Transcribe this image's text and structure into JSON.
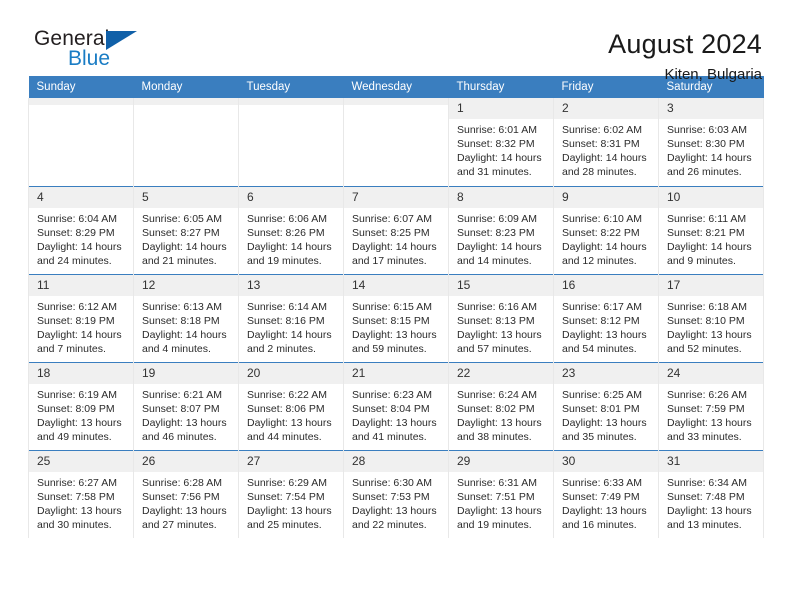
{
  "brand": {
    "name_part1": "General",
    "name_part2": "Blue",
    "triangle_icon": "triangle-icon",
    "accent_color": "#1060a8",
    "link_color": "#1a7cc4"
  },
  "header": {
    "title": "August 2024",
    "subtitle": "Kiten, Bulgaria"
  },
  "calendar": {
    "header_bg": "#3a7ebf",
    "daynum_bg": "#f0f0f0",
    "weekday_headers": [
      "Sunday",
      "Monday",
      "Tuesday",
      "Wednesday",
      "Thursday",
      "Friday",
      "Saturday"
    ],
    "weeks": [
      [
        {
          "day": "",
          "empty": true,
          "sunrise": "",
          "sunset": "",
          "daylight_line1": "",
          "daylight_line2": ""
        },
        {
          "day": "",
          "empty": true,
          "sunrise": "",
          "sunset": "",
          "daylight_line1": "",
          "daylight_line2": ""
        },
        {
          "day": "",
          "empty": true,
          "sunrise": "",
          "sunset": "",
          "daylight_line1": "",
          "daylight_line2": ""
        },
        {
          "day": "",
          "empty": true,
          "sunrise": "",
          "sunset": "",
          "daylight_line1": "",
          "daylight_line2": ""
        },
        {
          "day": "1",
          "empty": false,
          "sunrise": "Sunrise: 6:01 AM",
          "sunset": "Sunset: 8:32 PM",
          "daylight_line1": "Daylight: 14 hours",
          "daylight_line2": "and 31 minutes."
        },
        {
          "day": "2",
          "empty": false,
          "sunrise": "Sunrise: 6:02 AM",
          "sunset": "Sunset: 8:31 PM",
          "daylight_line1": "Daylight: 14 hours",
          "daylight_line2": "and 28 minutes."
        },
        {
          "day": "3",
          "empty": false,
          "sunrise": "Sunrise: 6:03 AM",
          "sunset": "Sunset: 8:30 PM",
          "daylight_line1": "Daylight: 14 hours",
          "daylight_line2": "and 26 minutes."
        }
      ],
      [
        {
          "day": "4",
          "empty": false,
          "sunrise": "Sunrise: 6:04 AM",
          "sunset": "Sunset: 8:29 PM",
          "daylight_line1": "Daylight: 14 hours",
          "daylight_line2": "and 24 minutes."
        },
        {
          "day": "5",
          "empty": false,
          "sunrise": "Sunrise: 6:05 AM",
          "sunset": "Sunset: 8:27 PM",
          "daylight_line1": "Daylight: 14 hours",
          "daylight_line2": "and 21 minutes."
        },
        {
          "day": "6",
          "empty": false,
          "sunrise": "Sunrise: 6:06 AM",
          "sunset": "Sunset: 8:26 PM",
          "daylight_line1": "Daylight: 14 hours",
          "daylight_line2": "and 19 minutes."
        },
        {
          "day": "7",
          "empty": false,
          "sunrise": "Sunrise: 6:07 AM",
          "sunset": "Sunset: 8:25 PM",
          "daylight_line1": "Daylight: 14 hours",
          "daylight_line2": "and 17 minutes."
        },
        {
          "day": "8",
          "empty": false,
          "sunrise": "Sunrise: 6:09 AM",
          "sunset": "Sunset: 8:23 PM",
          "daylight_line1": "Daylight: 14 hours",
          "daylight_line2": "and 14 minutes."
        },
        {
          "day": "9",
          "empty": false,
          "sunrise": "Sunrise: 6:10 AM",
          "sunset": "Sunset: 8:22 PM",
          "daylight_line1": "Daylight: 14 hours",
          "daylight_line2": "and 12 minutes."
        },
        {
          "day": "10",
          "empty": false,
          "sunrise": "Sunrise: 6:11 AM",
          "sunset": "Sunset: 8:21 PM",
          "daylight_line1": "Daylight: 14 hours",
          "daylight_line2": "and 9 minutes."
        }
      ],
      [
        {
          "day": "11",
          "empty": false,
          "sunrise": "Sunrise: 6:12 AM",
          "sunset": "Sunset: 8:19 PM",
          "daylight_line1": "Daylight: 14 hours",
          "daylight_line2": "and 7 minutes."
        },
        {
          "day": "12",
          "empty": false,
          "sunrise": "Sunrise: 6:13 AM",
          "sunset": "Sunset: 8:18 PM",
          "daylight_line1": "Daylight: 14 hours",
          "daylight_line2": "and 4 minutes."
        },
        {
          "day": "13",
          "empty": false,
          "sunrise": "Sunrise: 6:14 AM",
          "sunset": "Sunset: 8:16 PM",
          "daylight_line1": "Daylight: 14 hours",
          "daylight_line2": "and 2 minutes."
        },
        {
          "day": "14",
          "empty": false,
          "sunrise": "Sunrise: 6:15 AM",
          "sunset": "Sunset: 8:15 PM",
          "daylight_line1": "Daylight: 13 hours",
          "daylight_line2": "and 59 minutes."
        },
        {
          "day": "15",
          "empty": false,
          "sunrise": "Sunrise: 6:16 AM",
          "sunset": "Sunset: 8:13 PM",
          "daylight_line1": "Daylight: 13 hours",
          "daylight_line2": "and 57 minutes."
        },
        {
          "day": "16",
          "empty": false,
          "sunrise": "Sunrise: 6:17 AM",
          "sunset": "Sunset: 8:12 PM",
          "daylight_line1": "Daylight: 13 hours",
          "daylight_line2": "and 54 minutes."
        },
        {
          "day": "17",
          "empty": false,
          "sunrise": "Sunrise: 6:18 AM",
          "sunset": "Sunset: 8:10 PM",
          "daylight_line1": "Daylight: 13 hours",
          "daylight_line2": "and 52 minutes."
        }
      ],
      [
        {
          "day": "18",
          "empty": false,
          "sunrise": "Sunrise: 6:19 AM",
          "sunset": "Sunset: 8:09 PM",
          "daylight_line1": "Daylight: 13 hours",
          "daylight_line2": "and 49 minutes."
        },
        {
          "day": "19",
          "empty": false,
          "sunrise": "Sunrise: 6:21 AM",
          "sunset": "Sunset: 8:07 PM",
          "daylight_line1": "Daylight: 13 hours",
          "daylight_line2": "and 46 minutes."
        },
        {
          "day": "20",
          "empty": false,
          "sunrise": "Sunrise: 6:22 AM",
          "sunset": "Sunset: 8:06 PM",
          "daylight_line1": "Daylight: 13 hours",
          "daylight_line2": "and 44 minutes."
        },
        {
          "day": "21",
          "empty": false,
          "sunrise": "Sunrise: 6:23 AM",
          "sunset": "Sunset: 8:04 PM",
          "daylight_line1": "Daylight: 13 hours",
          "daylight_line2": "and 41 minutes."
        },
        {
          "day": "22",
          "empty": false,
          "sunrise": "Sunrise: 6:24 AM",
          "sunset": "Sunset: 8:02 PM",
          "daylight_line1": "Daylight: 13 hours",
          "daylight_line2": "and 38 minutes."
        },
        {
          "day": "23",
          "empty": false,
          "sunrise": "Sunrise: 6:25 AM",
          "sunset": "Sunset: 8:01 PM",
          "daylight_line1": "Daylight: 13 hours",
          "daylight_line2": "and 35 minutes."
        },
        {
          "day": "24",
          "empty": false,
          "sunrise": "Sunrise: 6:26 AM",
          "sunset": "Sunset: 7:59 PM",
          "daylight_line1": "Daylight: 13 hours",
          "daylight_line2": "and 33 minutes."
        }
      ],
      [
        {
          "day": "25",
          "empty": false,
          "sunrise": "Sunrise: 6:27 AM",
          "sunset": "Sunset: 7:58 PM",
          "daylight_line1": "Daylight: 13 hours",
          "daylight_line2": "and 30 minutes."
        },
        {
          "day": "26",
          "empty": false,
          "sunrise": "Sunrise: 6:28 AM",
          "sunset": "Sunset: 7:56 PM",
          "daylight_line1": "Daylight: 13 hours",
          "daylight_line2": "and 27 minutes."
        },
        {
          "day": "27",
          "empty": false,
          "sunrise": "Sunrise: 6:29 AM",
          "sunset": "Sunset: 7:54 PM",
          "daylight_line1": "Daylight: 13 hours",
          "daylight_line2": "and 25 minutes."
        },
        {
          "day": "28",
          "empty": false,
          "sunrise": "Sunrise: 6:30 AM",
          "sunset": "Sunset: 7:53 PM",
          "daylight_line1": "Daylight: 13 hours",
          "daylight_line2": "and 22 minutes."
        },
        {
          "day": "29",
          "empty": false,
          "sunrise": "Sunrise: 6:31 AM",
          "sunset": "Sunset: 7:51 PM",
          "daylight_line1": "Daylight: 13 hours",
          "daylight_line2": "and 19 minutes."
        },
        {
          "day": "30",
          "empty": false,
          "sunrise": "Sunrise: 6:33 AM",
          "sunset": "Sunset: 7:49 PM",
          "daylight_line1": "Daylight: 13 hours",
          "daylight_line2": "and 16 minutes."
        },
        {
          "day": "31",
          "empty": false,
          "sunrise": "Sunrise: 6:34 AM",
          "sunset": "Sunset: 7:48 PM",
          "daylight_line1": "Daylight: 13 hours",
          "daylight_line2": "and 13 minutes."
        }
      ]
    ]
  }
}
